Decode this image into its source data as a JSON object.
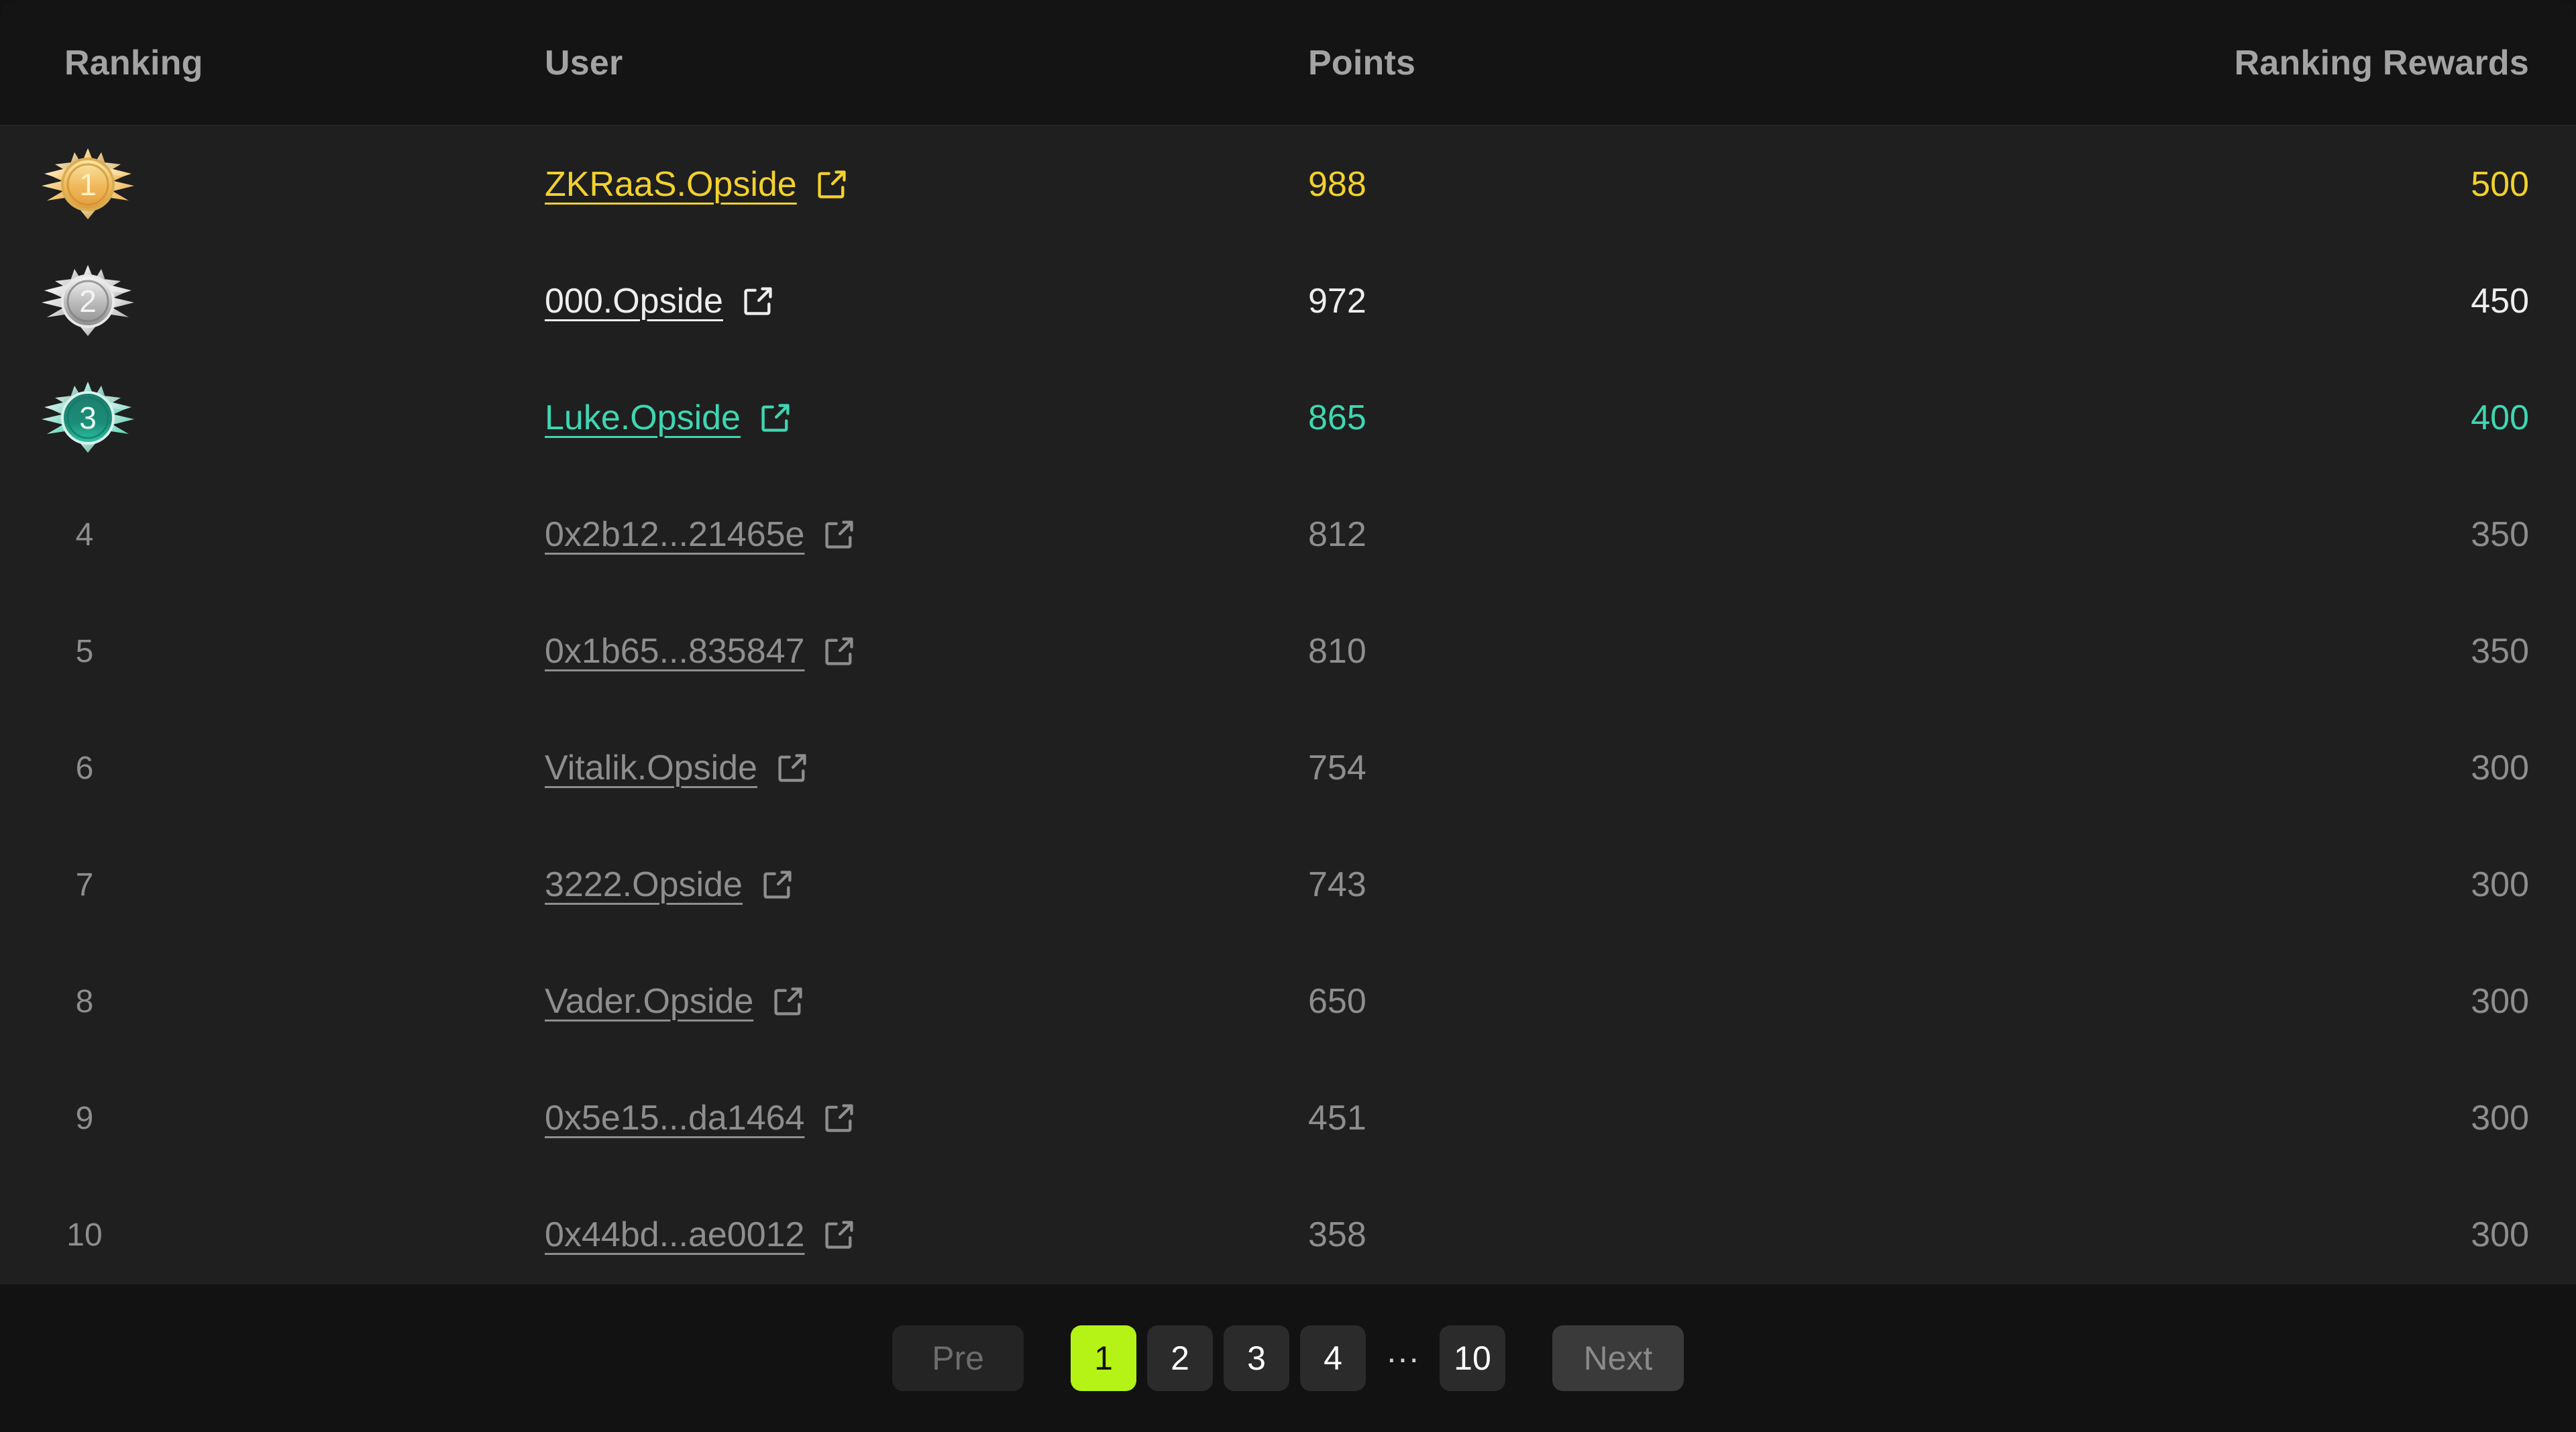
{
  "table": {
    "columns": [
      {
        "key": "ranking",
        "label": "Ranking"
      },
      {
        "key": "user",
        "label": "User"
      },
      {
        "key": "points",
        "label": "Points"
      },
      {
        "key": "reward",
        "label": "Ranking Rewards"
      }
    ],
    "rows": [
      {
        "rank": "1",
        "medal": "gold-medal-icon",
        "user": "ZKRaaS.Opside",
        "points": "988",
        "reward": "500",
        "tier": "gold",
        "link_icon": "external-link-icon"
      },
      {
        "rank": "2",
        "medal": "silver-medal-icon",
        "user": "000.Opside",
        "points": "972",
        "reward": "450",
        "tier": "silver",
        "link_icon": "external-link-icon"
      },
      {
        "rank": "3",
        "medal": "bronze-medal-icon",
        "user": "Luke.Opside",
        "points": "865",
        "reward": "400",
        "tier": "bronze",
        "link_icon": "external-link-icon"
      },
      {
        "rank": "4",
        "medal": null,
        "user": "0x2b12...21465e",
        "points": "812",
        "reward": "350",
        "tier": "plain",
        "link_icon": "external-link-icon"
      },
      {
        "rank": "5",
        "medal": null,
        "user": "0x1b65...835847",
        "points": "810",
        "reward": "350",
        "tier": "plain",
        "link_icon": "external-link-icon"
      },
      {
        "rank": "6",
        "medal": null,
        "user": "Vitalik.Opside",
        "points": "754",
        "reward": "300",
        "tier": "plain",
        "link_icon": "external-link-icon"
      },
      {
        "rank": "7",
        "medal": null,
        "user": "3222.Opside",
        "points": "743",
        "reward": "300",
        "tier": "plain",
        "link_icon": "external-link-icon"
      },
      {
        "rank": "8",
        "medal": null,
        "user": "Vader.Opside",
        "points": "650",
        "reward": "300",
        "tier": "plain",
        "link_icon": "external-link-icon"
      },
      {
        "rank": "9",
        "medal": null,
        "user": "0x5e15...da1464",
        "points": "451",
        "reward": "300",
        "tier": "plain",
        "link_icon": "external-link-icon"
      },
      {
        "rank": "10",
        "medal": null,
        "user": "0x44bd...ae0012",
        "points": "358",
        "reward": "300",
        "tier": "plain",
        "link_icon": "external-link-icon"
      }
    ]
  },
  "pagination": {
    "prev_label": "Pre",
    "next_label": "Next",
    "ellipsis": "···",
    "pages": [
      "1",
      "2",
      "3",
      "4"
    ],
    "last_page": "10",
    "current_page": "1",
    "prev_disabled": true,
    "next_disabled": true
  },
  "colors": {
    "gold": "#f2d12e",
    "silver": "#eeeeee",
    "bronze": "#3fd6b2",
    "muted": "#8e8e8e",
    "accent_active_page": "#b5f215",
    "header_bg": "#141414",
    "body_bg": "#1f1f1f",
    "footer_bg": "#121212"
  }
}
